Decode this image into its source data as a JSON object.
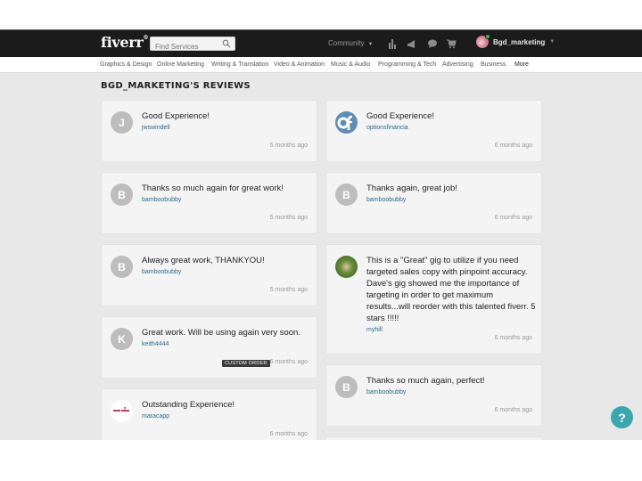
{
  "header": {
    "logo": "fiverr",
    "logo_mark": "®",
    "search_placeholder": "Find Services",
    "community_label": "Community",
    "icons": [
      "bar-chart-icon",
      "megaphone-icon",
      "chat-bubble-icon",
      "cart-icon"
    ],
    "username": "Bgd_marketing",
    "user_online_color": "#35b84a"
  },
  "categories": [
    "Graphics & Design",
    "Online Marketing",
    "Writing & Translation",
    "Video & Animation",
    "Music & Audio",
    "Programming & Tech",
    "Advertising",
    "Business",
    "More"
  ],
  "page": {
    "title": "BGD_MARKETING'S REVIEWS"
  },
  "reviews_left": [
    {
      "avatar": "J",
      "text": "Good Experience!",
      "author": "jwswindell",
      "time": "5 months ago"
    },
    {
      "avatar": "B",
      "text": "Thanks so much again for great work!",
      "author": "bamboobubby",
      "time": "5 months ago"
    },
    {
      "avatar": "B",
      "text": "Always great work, THANKYOU!",
      "author": "bamboobubby",
      "time": "5 months ago"
    },
    {
      "avatar": "K",
      "text": "Great work. Will be using again very soon.",
      "author": "keith4444",
      "time": "6 months ago",
      "badge": "CUSTOM ORDER"
    },
    {
      "avatar": "",
      "avatar_image": "maracapp-logo",
      "text": "Outstanding Experience!",
      "author": "maracapp",
      "time": "6 months ago"
    }
  ],
  "reviews_right": [
    {
      "avatar": "",
      "avatar_image": "optionsfinancia-logo",
      "text": "Good Experience!",
      "author": "optionsfinancia",
      "time": "6 months ago"
    },
    {
      "avatar": "B",
      "text": "Thanks again, great job!",
      "author": "bamboobubby",
      "time": "6 months ago"
    },
    {
      "avatar": "",
      "avatar_image": "myhill-photo",
      "text": "This is a \"Great\" gig to utilize if you need targeted sales copy with pinpoint accuracy. Dave's gig showed me the importance of targeting in order to get maximum results...will reorder with this talented fiverr. 5 stars !!!!!",
      "author": "myhill",
      "time": "6 months ago"
    },
    {
      "avatar": "B",
      "text": "Thanks so much again, perfect!",
      "author": "bamboobubby",
      "time": "6 months ago"
    }
  ],
  "help_button": "?",
  "colors": {
    "header_bg": "#1b1b1b",
    "link": "#2b6b91",
    "help": "#3aa6ae",
    "page_bg": "#e8e8e8",
    "card_bg": "#f4f4f4"
  }
}
